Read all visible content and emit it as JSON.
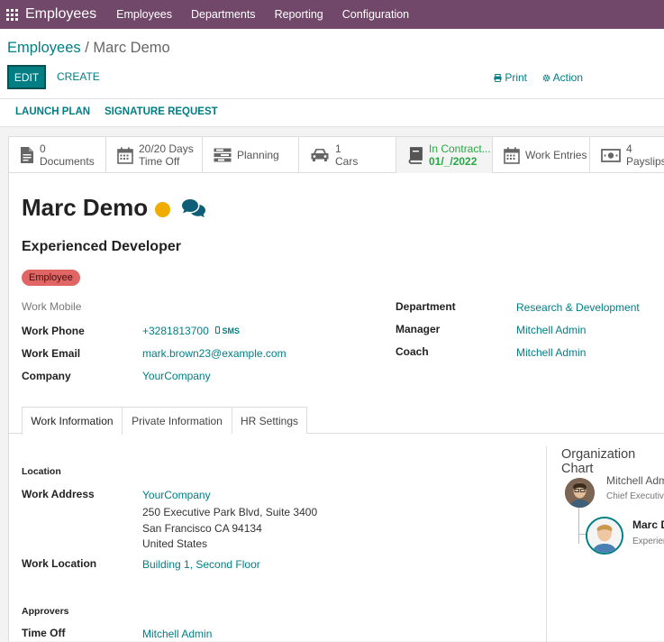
{
  "topbar": {
    "brand": "Employees",
    "menu": [
      "Employees",
      "Departments",
      "Reporting",
      "Configuration"
    ]
  },
  "breadcrumb": {
    "parent": "Employees",
    "separator": "/",
    "current": "Marc Demo"
  },
  "buttons": {
    "edit": "EDIT",
    "create": "CREATE",
    "print": "Print",
    "action": "Action"
  },
  "status_buttons": {
    "launch_plan": "LAUNCH PLAN",
    "signature_request": "SIGNATURE REQUEST"
  },
  "smart_buttons": [
    {
      "value": "0",
      "label": "Documents",
      "icon": "document-icon"
    },
    {
      "value": "20/20 Days",
      "label": "Time Off",
      "icon": "calendar-icon"
    },
    {
      "value": "",
      "label": "Planning",
      "icon": "planning-icon"
    },
    {
      "value": "1",
      "label": "Cars",
      "icon": "car-icon"
    },
    {
      "value": "In Contract...",
      "label": "01/_/2022",
      "icon": "book-icon"
    },
    {
      "value": "",
      "label": "Work Entries",
      "icon": "calendar-icon"
    },
    {
      "value": "4",
      "label": "Payslips",
      "icon": "money-icon"
    }
  ],
  "employee": {
    "name": "Marc Demo",
    "job_title": "Experienced Developer",
    "tag": "Employee",
    "presence_color": "#f0ad00"
  },
  "fields_left": {
    "work_mobile": {
      "label": "Work Mobile",
      "value": ""
    },
    "work_phone": {
      "label": "Work Phone",
      "value": "+3281813700",
      "sms": "SMS"
    },
    "work_email": {
      "label": "Work Email",
      "value": "mark.brown23@example.com"
    },
    "company": {
      "label": "Company",
      "value": "YourCompany"
    }
  },
  "fields_right": {
    "department": {
      "label": "Department",
      "value": "Research & Development"
    },
    "manager": {
      "label": "Manager",
      "value": "Mitchell Admin"
    },
    "coach": {
      "label": "Coach",
      "value": "Mitchell Admin"
    }
  },
  "tabs": [
    "Work Information",
    "Private Information",
    "HR Settings"
  ],
  "work_info": {
    "location_heading": "Location",
    "work_address_label": "Work Address",
    "address_company": "YourCompany",
    "address_street": "250 Executive Park Blvd, Suite 3400",
    "address_city": "San Francisco CA 94134",
    "address_country": "United States",
    "work_location_label": "Work Location",
    "work_location": "Building 1, Second Floor",
    "approvers_heading": "Approvers",
    "time_off_label": "Time Off",
    "time_off_value": "Mitchell Admin"
  },
  "org_chart": {
    "title": "Organization Chart",
    "manager_name": "Mitchell Adm",
    "manager_role": "Chief Executiv",
    "employee_name": "Marc D",
    "employee_role": "Experien"
  },
  "colors": {
    "brand": "#71486a",
    "accent": "#017e84",
    "tag": "#e06666"
  }
}
